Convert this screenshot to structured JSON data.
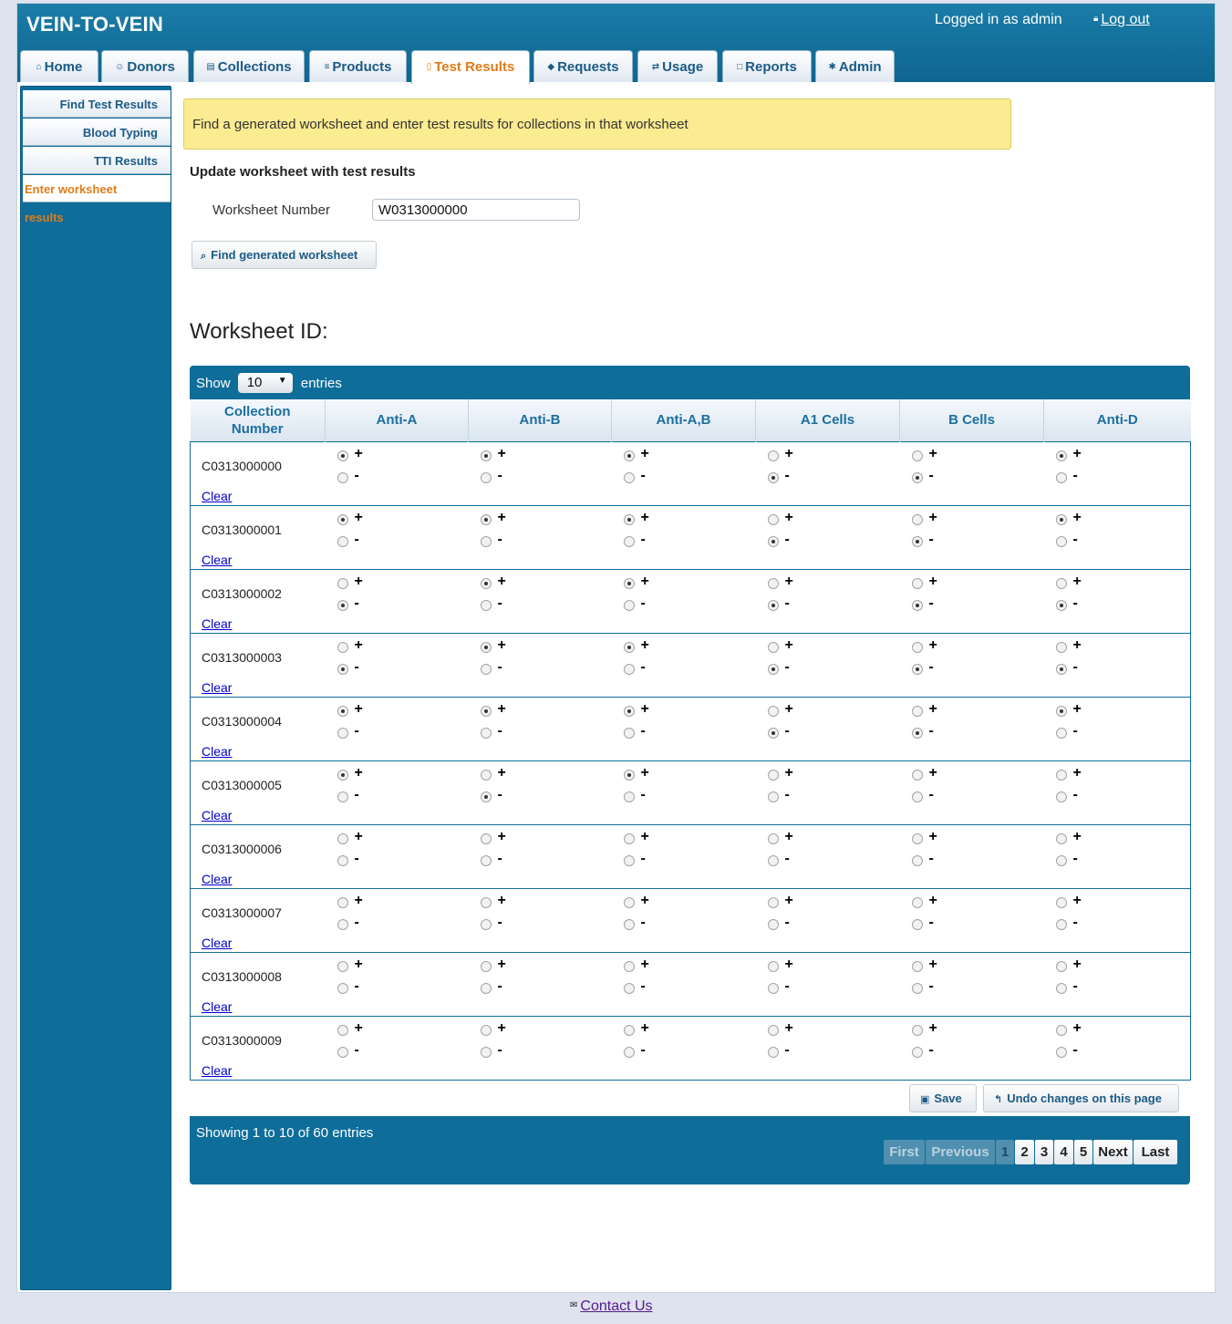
{
  "app": {
    "title": "VEIN-TO-VEIN",
    "login_status": "Logged in as admin",
    "logout_label": "Log out"
  },
  "tabs": [
    {
      "label": "Home",
      "icon": "home-icon",
      "active": false
    },
    {
      "label": "Donors",
      "icon": "person-icon",
      "active": false
    },
    {
      "label": "Collections",
      "icon": "list-icon",
      "active": false
    },
    {
      "label": "Products",
      "icon": "cart-icon",
      "active": false
    },
    {
      "label": "Test Results",
      "icon": "book-icon",
      "active": true
    },
    {
      "label": "Requests",
      "icon": "tag-icon",
      "active": false
    },
    {
      "label": "Usage",
      "icon": "transfer-icon",
      "active": false
    },
    {
      "label": "Reports",
      "icon": "clipboard-icon",
      "active": false
    },
    {
      "label": "Admin",
      "icon": "gear-icon",
      "active": false
    }
  ],
  "sidebar": {
    "items": [
      {
        "label": "Find Test Results",
        "active": false
      },
      {
        "label": "Blood Typing",
        "active": false
      },
      {
        "label": "TTI Results",
        "active": false
      },
      {
        "label": "Enter worksheet results",
        "active": true
      }
    ]
  },
  "notice": "Find a generated worksheet and enter test results for collections in that worksheet",
  "form": {
    "title": "Update worksheet with test results",
    "worksheet_label": "Worksheet Number",
    "worksheet_value": "W0313000000",
    "find_button": "Find generated worksheet"
  },
  "worksheet_title": "Worksheet ID:",
  "grid": {
    "show_label": "Show",
    "entries_label": "entries",
    "page_length": "10",
    "columns": [
      "Collection Number",
      "Anti-A",
      "Anti-B",
      "Anti-A,B",
      "A1 Cells",
      "B Cells",
      "Anti-D"
    ],
    "plus_label": "+",
    "minus_label": "-",
    "clear_label": "Clear",
    "colors": {
      "saved": "#006429",
      "edited": "#c4d9e6",
      "header": "#0f6d9a",
      "active_accent": "#e07b17"
    },
    "rows": [
      {
        "collection": "C0313000000",
        "results": [
          "+",
          "+",
          "+",
          "-",
          "-",
          "+"
        ],
        "states": [
          "saved",
          "saved",
          "saved",
          "saved",
          "saved",
          "saved"
        ]
      },
      {
        "collection": "C0313000001",
        "results": [
          "+",
          "+",
          "+",
          "-",
          "-",
          "+"
        ],
        "states": [
          "saved",
          "saved",
          "saved",
          "saved",
          "saved",
          "saved"
        ]
      },
      {
        "collection": "C0313000002",
        "results": [
          "-",
          "+",
          "+",
          "-",
          "-",
          "-"
        ],
        "states": [
          "saved",
          "saved",
          "saved",
          "saved",
          "saved",
          "saved"
        ]
      },
      {
        "collection": "C0313000003",
        "results": [
          "-",
          "+",
          "+",
          "-",
          "-",
          "-"
        ],
        "states": [
          "saved",
          "saved",
          "saved",
          "saved",
          "saved",
          "saved"
        ]
      },
      {
        "collection": "C0313000004",
        "results": [
          "+",
          "+",
          "+",
          "-",
          "-",
          "+"
        ],
        "states": [
          "edited",
          "edited",
          "edited",
          "edited",
          "edited",
          "edited"
        ]
      },
      {
        "collection": "C0313000005",
        "results": [
          "+",
          "-",
          "+",
          "",
          "",
          ""
        ],
        "states": [
          "edited",
          "edited",
          "edited",
          "none",
          "none",
          "none"
        ]
      },
      {
        "collection": "C0313000006",
        "results": [
          "",
          "",
          "",
          "",
          "",
          ""
        ],
        "states": [
          "none",
          "none",
          "none",
          "none",
          "none",
          "none"
        ]
      },
      {
        "collection": "C0313000007",
        "results": [
          "",
          "",
          "",
          "",
          "",
          ""
        ],
        "states": [
          "none",
          "none",
          "none",
          "none",
          "none",
          "none"
        ]
      },
      {
        "collection": "C0313000008",
        "results": [
          "",
          "",
          "",
          "",
          "",
          ""
        ],
        "states": [
          "none",
          "none",
          "none",
          "none",
          "none",
          "none"
        ]
      },
      {
        "collection": "C0313000009",
        "results": [
          "",
          "",
          "",
          "",
          "",
          ""
        ],
        "states": [
          "none",
          "none",
          "none",
          "none",
          "none",
          "none"
        ]
      }
    ],
    "save_button": "Save",
    "undo_button": "Undo changes on this page",
    "info": "Showing 1 to 10 of 60 entries",
    "pagination": {
      "first": "First",
      "previous": "Previous",
      "pages": [
        "1",
        "2",
        "3",
        "4",
        "5"
      ],
      "current_page": "1",
      "next": "Next",
      "last": "Last"
    }
  },
  "footer": {
    "contact_label": "Contact Us"
  }
}
